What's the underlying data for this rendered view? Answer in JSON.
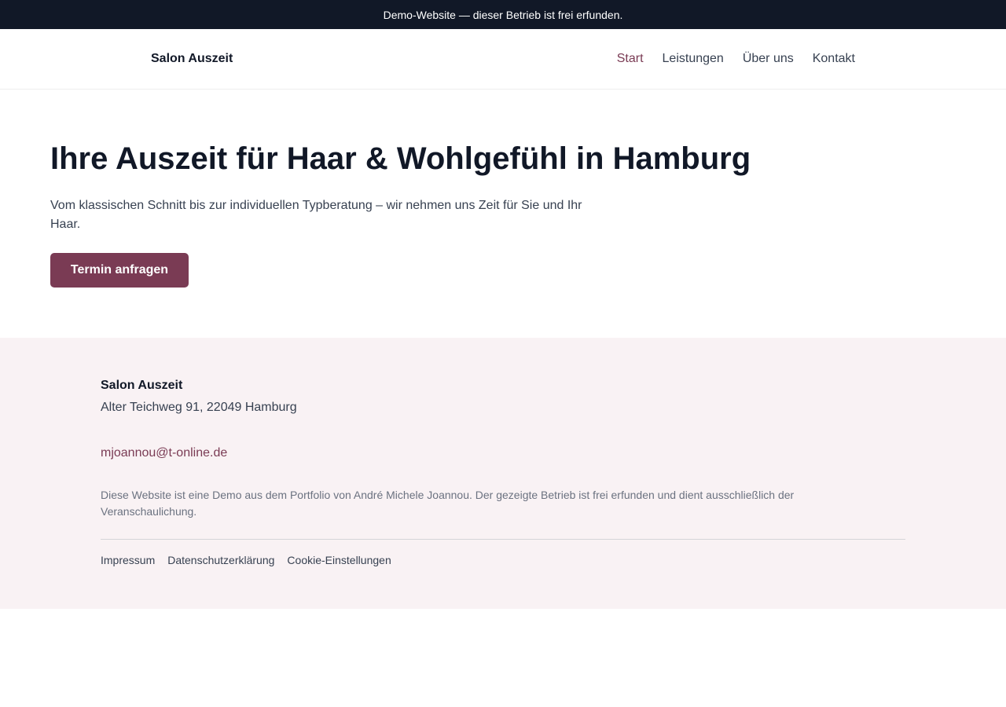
{
  "topbar": {
    "text": "Demo-Website — dieser Betrieb ist frei erfunden."
  },
  "header": {
    "brand": "Salon Auszeit",
    "nav": [
      {
        "label": "Start",
        "active": true
      },
      {
        "label": "Leistungen",
        "active": false
      },
      {
        "label": "Über uns",
        "active": false
      },
      {
        "label": "Kontakt",
        "active": false
      }
    ]
  },
  "hero": {
    "title": "Ihre Auszeit für Haar & Wohlgefühl in Hamburg",
    "text": "Vom klassischen Schnitt bis zur individuellen Typberatung – wir nehmen uns Zeit für Sie und Ihr Haar.",
    "cta_label": "Termin anfragen"
  },
  "footer": {
    "name": "Salon Auszeit",
    "address": "Alter Teichweg 91, 22049 Hamburg",
    "email": "mjoannou@t-online.de",
    "note": "Diese Website ist eine Demo aus dem Portfolio von André Michele Joannou. Der gezeigte Betrieb ist frei erfunden und dient ausschließlich der Veranschaulichung.",
    "links": [
      "Impressum",
      "Datenschutzerklärung",
      "Cookie-Einstellungen"
    ]
  },
  "colors": {
    "accent": "#7a3b54",
    "topbar_bg": "#111827",
    "footer_bg": "#f9f2f4"
  }
}
